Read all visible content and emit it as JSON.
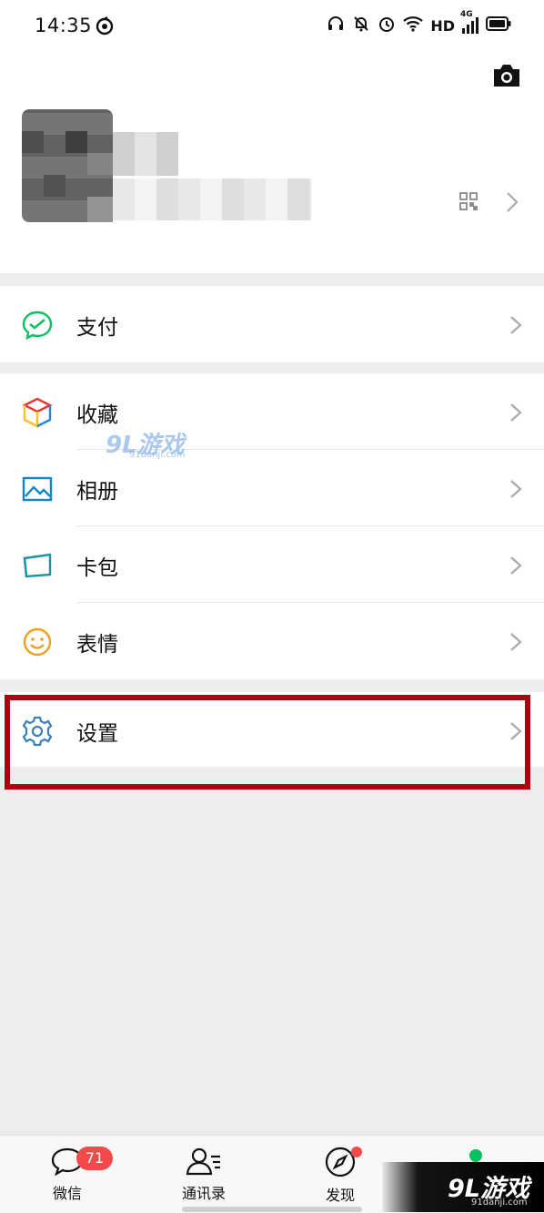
{
  "status_bar": {
    "time": "14:35",
    "network_label": "HD",
    "signal_label": "4G"
  },
  "profile": {
    "camera_icon": "camera-icon",
    "qr_icon": "qr-code-icon"
  },
  "menu": {
    "pay": {
      "label": "支付",
      "icon": "wechat-pay-icon",
      "color": "#07c160"
    },
    "favorites": {
      "label": "收藏",
      "icon": "cube-icon"
    },
    "album": {
      "label": "相册",
      "icon": "image-icon",
      "color": "#1485c8"
    },
    "cards": {
      "label": "卡包",
      "icon": "card-icon",
      "color": "#1c94a8"
    },
    "stickers": {
      "label": "表情",
      "icon": "smiley-icon",
      "color": "#f0a020"
    },
    "settings": {
      "label": "设置",
      "icon": "gear-icon",
      "color": "#3d7fb8"
    }
  },
  "highlight_color": "#b0000b",
  "watermark": {
    "brand": "9L游戏",
    "site": "91danji.com"
  },
  "tabbar": {
    "tabs": [
      {
        "label": "微信",
        "icon": "chat-icon"
      },
      {
        "label": "通讯录",
        "icon": "contacts-icon"
      },
      {
        "label": "发现",
        "icon": "compass-icon"
      }
    ],
    "chat_badge": "71"
  }
}
